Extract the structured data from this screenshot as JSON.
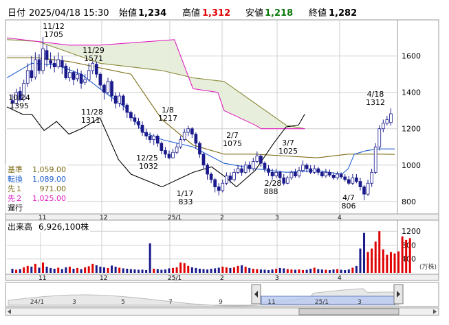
{
  "header": {
    "date_label": "日付",
    "date_value": "2025/04/18 15:30",
    "open_label": "始値",
    "open_value": "1,234",
    "high_label": "高値",
    "high_value": "1,312",
    "low_label": "安値",
    "low_value": "1,218",
    "close_label": "終値",
    "close_value": "1,282"
  },
  "legend": [
    {
      "label": "基準",
      "value": "1,059.00",
      "color": "#7a6a12"
    },
    {
      "label": "転換",
      "value": "1,089.00",
      "color": "#2060d0"
    },
    {
      "label": "先１",
      "value": "971.00",
      "color": "#7a6a12"
    },
    {
      "label": "先２",
      "value": "1,025.00",
      "color": "#e020c0"
    },
    {
      "label": "遅行",
      "value": "",
      "color": "#000000"
    }
  ],
  "volume_label": "出来高",
  "volume_value": "6,926,100株",
  "volume_unit": "(万株)",
  "colors": {
    "up": "#e00000",
    "down": "#1a1a8c",
    "tenkan": "#2060d0",
    "kijun": "#7a6a12",
    "span_a": "#8a8a3a",
    "span_b": "#e020c0",
    "chikou": "#000000",
    "cloud": "#e6ecd8",
    "grid": "#cfcfcf"
  },
  "chart_data": [
    {
      "type": "candlestick",
      "title": "",
      "y_ticks": [
        "1600",
        "1400",
        "1200",
        "1000",
        "800"
      ],
      "ylim": [
        735,
        1795
      ],
      "x_ticks": [
        "11",
        "12",
        "25/1",
        "2",
        "3",
        "4"
      ],
      "annotations": [
        {
          "date": "11/12",
          "value": "1705"
        },
        {
          "date": "11/29",
          "value": "1571"
        },
        {
          "date": "10/24",
          "value": "1395"
        },
        {
          "date": "11/28",
          "value": "1311"
        },
        {
          "date": "1/8",
          "value": "1217"
        },
        {
          "date": "12/25",
          "value": "1032"
        },
        {
          "date": "1/17",
          "value": "833"
        },
        {
          "date": "2/7",
          "value": "1075"
        },
        {
          "date": "2/28",
          "value": "888"
        },
        {
          "date": "3/7",
          "value": "1025"
        },
        {
          "date": "4/7",
          "value": "806"
        },
        {
          "date": "4/18",
          "value": "1312"
        }
      ],
      "series": [
        {
          "name": "基準",
          "x": [
            0,
            10,
            20,
            40,
            50,
            60,
            70,
            80,
            90,
            100,
            110,
            120,
            125
          ],
          "values": [
            1590,
            1590,
            1570,
            1500,
            1250,
            1110,
            1060,
            1060,
            1050,
            1040,
            1060,
            1060,
            1059
          ]
        },
        {
          "name": "転換",
          "x": [
            0,
            8,
            16,
            24,
            30,
            38,
            44,
            50,
            60,
            70,
            80,
            90,
            100,
            108,
            110,
            112,
            116,
            120,
            125
          ],
          "values": [
            1480,
            1560,
            1550,
            1500,
            1420,
            1320,
            1180,
            1140,
            1100,
            1010,
            980,
            960,
            970,
            950,
            980,
            1060,
            1080,
            1089,
            1089
          ]
        },
        {
          "name": "先１",
          "x": [
            0,
            10,
            20,
            30,
            40,
            50,
            60,
            70,
            80,
            90,
            96
          ],
          "values": [
            1690,
            1680,
            1620,
            1560,
            1540,
            1520,
            1480,
            1460,
            1340,
            1220,
            1200
          ]
        },
        {
          "name": "先２",
          "x": [
            0,
            10,
            20,
            30,
            54,
            60,
            68,
            70,
            80,
            82,
            90,
            96
          ],
          "values": [
            1700,
            1680,
            1660,
            1660,
            1690,
            1420,
            1400,
            1300,
            1220,
            1200,
            1200,
            1200
          ]
        },
        {
          "name": "遅行",
          "x": [
            0,
            5,
            8,
            12,
            16,
            20,
            24,
            30,
            36,
            40,
            50,
            60,
            66,
            70,
            74,
            80,
            86,
            90,
            94,
            96
          ],
          "values": [
            1320,
            1280,
            1280,
            1190,
            1240,
            1170,
            1200,
            1260,
            1030,
            950,
            880,
            960,
            990,
            940,
            880,
            970,
            1120,
            1210,
            1220,
            1280
          ]
        }
      ],
      "candles_ohlc": [
        [
          1355,
          1340,
          1390,
          1310
        ],
        [
          1340,
          1400,
          1420,
          1330
        ],
        [
          1405,
          1360,
          1430,
          1350
        ],
        [
          1360,
          1450,
          1470,
          1350
        ],
        [
          1450,
          1520,
          1560,
          1430
        ],
        [
          1520,
          1480,
          1600,
          1460
        ],
        [
          1485,
          1580,
          1620,
          1470
        ],
        [
          1580,
          1520,
          1610,
          1500
        ],
        [
          1520,
          1640,
          1705,
          1500
        ],
        [
          1630,
          1580,
          1660,
          1540
        ],
        [
          1575,
          1560,
          1620,
          1530
        ],
        [
          1560,
          1540,
          1600,
          1510
        ],
        [
          1540,
          1580,
          1620,
          1530
        ],
        [
          1575,
          1540,
          1600,
          1500
        ],
        [
          1545,
          1480,
          1560,
          1470
        ],
        [
          1480,
          1510,
          1540,
          1460
        ],
        [
          1510,
          1470,
          1520,
          1440
        ],
        [
          1475,
          1500,
          1530,
          1460
        ],
        [
          1500,
          1450,
          1520,
          1420
        ],
        [
          1455,
          1470,
          1500,
          1440
        ],
        [
          1470,
          1520,
          1560,
          1460
        ],
        [
          1520,
          1560,
          1571,
          1500
        ],
        [
          1555,
          1500,
          1570,
          1480
        ],
        [
          1500,
          1440,
          1510,
          1420
        ],
        [
          1440,
          1400,
          1450,
          1360
        ],
        [
          1400,
          1460,
          1480,
          1390
        ],
        [
          1460,
          1380,
          1470,
          1350
        ],
        [
          1380,
          1340,
          1400,
          1311
        ],
        [
          1340,
          1380,
          1400,
          1320
        ],
        [
          1380,
          1330,
          1390,
          1300
        ],
        [
          1330,
          1290,
          1340,
          1260
        ],
        [
          1290,
          1260,
          1300,
          1240
        ],
        [
          1260,
          1240,
          1280,
          1220
        ],
        [
          1240,
          1220,
          1260,
          1200
        ],
        [
          1220,
          1180,
          1240,
          1160
        ],
        [
          1180,
          1160,
          1200,
          1140
        ],
        [
          1160,
          1140,
          1180,
          1120
        ],
        [
          1140,
          1160,
          1170,
          1110
        ],
        [
          1160,
          1120,
          1170,
          1100
        ],
        [
          1120,
          1080,
          1130,
          1060
        ],
        [
          1080,
          1060,
          1100,
          1040
        ],
        [
          1060,
          1040,
          1080,
          1032
        ],
        [
          1040,
          1070,
          1090,
          1035
        ],
        [
          1070,
          1100,
          1120,
          1060
        ],
        [
          1100,
          1140,
          1160,
          1090
        ],
        [
          1140,
          1180,
          1200,
          1130
        ],
        [
          1180,
          1200,
          1217,
          1160
        ],
        [
          1200,
          1170,
          1210,
          1150
        ],
        [
          1170,
          1120,
          1180,
          1090
        ],
        [
          1120,
          1060,
          1130,
          1040
        ],
        [
          1060,
          1000,
          1070,
          980
        ],
        [
          1000,
          950,
          1010,
          920
        ],
        [
          950,
          920,
          960,
          900
        ],
        [
          920,
          880,
          930,
          850
        ],
        [
          880,
          860,
          900,
          833
        ],
        [
          860,
          900,
          920,
          850
        ],
        [
          900,
          940,
          960,
          890
        ],
        [
          940,
          920,
          960,
          900
        ],
        [
          920,
          960,
          980,
          910
        ],
        [
          960,
          980,
          1000,
          950
        ],
        [
          980,
          960,
          1000,
          940
        ],
        [
          960,
          1000,
          1020,
          950
        ],
        [
          1000,
          980,
          1020,
          960
        ],
        [
          980,
          1020,
          1040,
          970
        ],
        [
          1020,
          1050,
          1075,
          1010
        ],
        [
          1050,
          1010,
          1060,
          990
        ],
        [
          1010,
          980,
          1020,
          960
        ],
        [
          980,
          960,
          1000,
          940
        ],
        [
          960,
          940,
          980,
          920
        ],
        [
          940,
          960,
          980,
          930
        ],
        [
          960,
          930,
          970,
          910
        ],
        [
          930,
          900,
          950,
          888
        ],
        [
          900,
          930,
          940,
          895
        ],
        [
          930,
          960,
          970,
          920
        ],
        [
          960,
          940,
          980,
          930
        ],
        [
          940,
          970,
          990,
          930
        ],
        [
          970,
          1000,
          1025,
          960
        ],
        [
          1000,
          980,
          1010,
          960
        ],
        [
          980,
          960,
          1000,
          950
        ],
        [
          960,
          980,
          1000,
          950
        ],
        [
          980,
          960,
          990,
          945
        ],
        [
          960,
          940,
          970,
          930
        ],
        [
          940,
          960,
          980,
          930
        ],
        [
          960,
          945,
          975,
          935
        ],
        [
          945,
          930,
          960,
          920
        ],
        [
          930,
          950,
          965,
          920
        ],
        [
          950,
          935,
          960,
          925
        ],
        [
          935,
          920,
          950,
          910
        ],
        [
          920,
          900,
          940,
          890
        ],
        [
          900,
          930,
          950,
          890
        ],
        [
          930,
          910,
          950,
          900
        ],
        [
          910,
          880,
          930,
          860
        ],
        [
          880,
          840,
          890,
          806
        ],
        [
          840,
          900,
          920,
          830
        ],
        [
          900,
          960,
          980,
          880
        ],
        [
          960,
          1100,
          1120,
          950
        ],
        [
          1100,
          1200,
          1220,
          1080
        ],
        [
          1200,
          1230,
          1250,
          1180
        ],
        [
          1230,
          1250,
          1270,
          1218
        ],
        [
          1234,
          1282,
          1312,
          1218
        ]
      ]
    },
    {
      "type": "bar",
      "title": "出来高",
      "y_ticks": [
        "1200",
        "800",
        "400"
      ],
      "ylim": [
        0,
        1500
      ],
      "x_ticks": [
        "11",
        "12",
        "25/1",
        "2",
        "3",
        "4"
      ],
      "values": [
        120,
        90,
        110,
        160,
        200,
        180,
        260,
        150,
        300,
        180,
        140,
        120,
        150,
        110,
        160,
        180,
        120,
        140,
        110,
        160,
        190,
        260,
        220,
        180,
        160,
        140,
        210,
        180,
        150,
        130,
        120,
        110,
        100,
        90,
        95,
        80,
        850,
        120,
        110,
        90,
        100,
        130,
        140,
        160,
        300,
        280,
        200,
        160,
        140,
        120,
        110,
        100,
        120,
        130,
        150,
        180,
        160,
        140,
        160,
        200,
        220,
        180,
        140,
        120,
        110,
        100,
        90,
        80,
        100,
        120,
        140,
        130,
        110,
        100,
        90,
        100,
        80,
        90,
        120,
        150,
        110,
        100,
        90,
        80,
        100,
        110,
        90,
        80,
        100,
        150,
        200,
        700,
        1150,
        600,
        700,
        900,
        1200,
        680,
        520,
        600,
        560,
        620,
        1050,
        950,
        1000
      ]
    }
  ],
  "navigator": {
    "labels": [
      "24/1",
      "3",
      "5",
      "7",
      "9",
      "11",
      "25/1",
      "3"
    ]
  }
}
